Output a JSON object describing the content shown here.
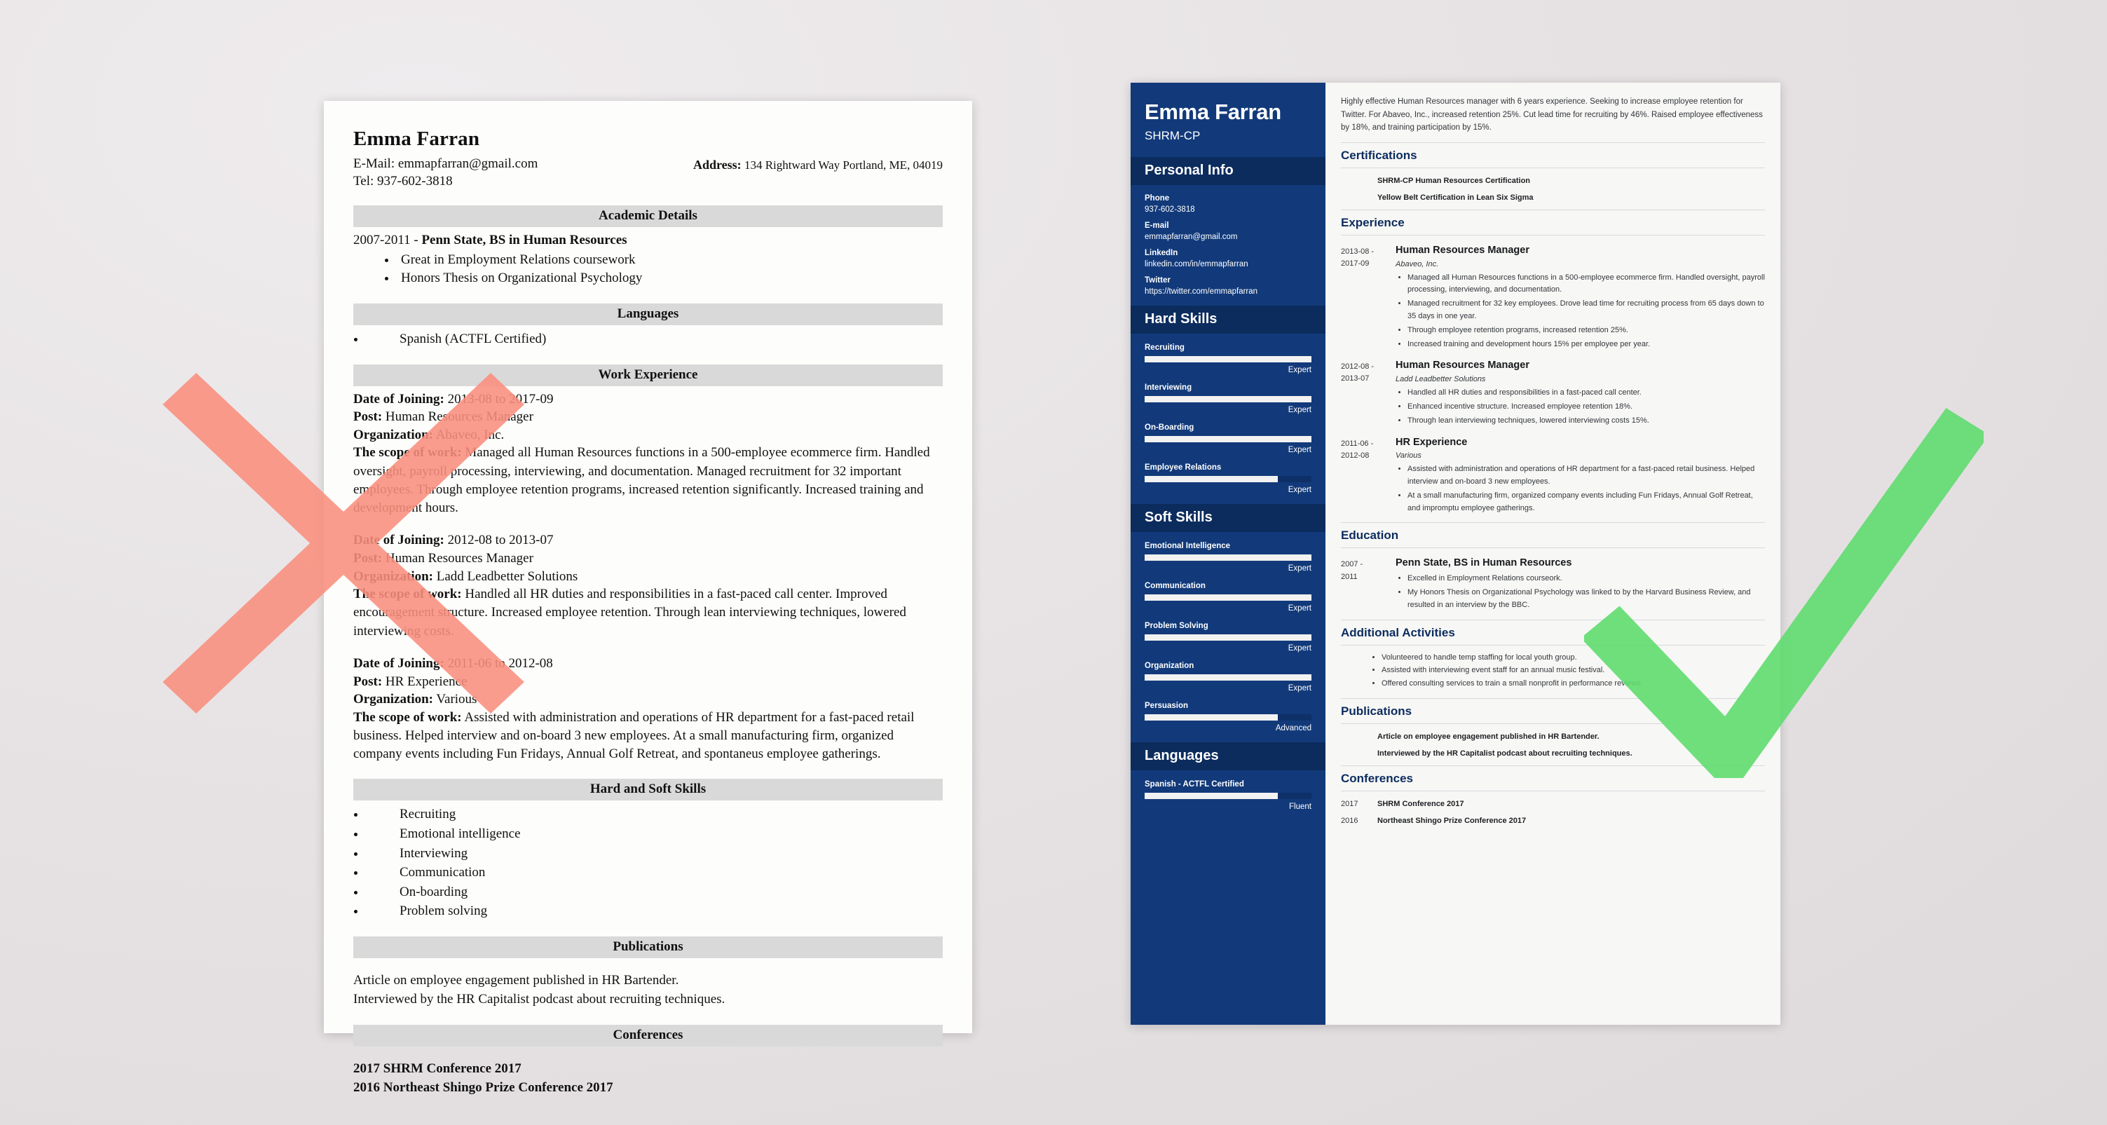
{
  "marks": {
    "reject_color": "#fa8f7e",
    "accept_color": "#5fdb6f",
    "reject_icon": "x-cross-icon",
    "accept_icon": "check-mark-icon"
  },
  "bad_resume": {
    "name": "Emma Farran",
    "email_line": "E-Mail: emmapfarran@gmail.com",
    "tel_line": "Tel: 937-602-3818",
    "address_label": "Address:",
    "address_value": "134 Rightward Way Portland, ME, 04019",
    "sections": {
      "academic": "Academic Details",
      "languages": "Languages",
      "work": "Work Experience",
      "skills": "Hard and Soft Skills",
      "publications": "Publications",
      "conferences": "Conferences"
    },
    "academic": {
      "line": "2007-2011 - Penn State, BS in Human Resources",
      "years": "2007-2011 - ",
      "degree": "Penn State, BS in Human Resources",
      "bullets": [
        "Great in Employment Relations coursework",
        "Honors Thesis on Organizational Psychology"
      ]
    },
    "languages": [
      "Spanish (ACTFL Certified)"
    ],
    "jobs": [
      {
        "date_label": "Date of Joining:",
        "date_value": " 2013-08 to 2017-09",
        "post_label": "Post:",
        "post_value": " Human Resources Manager",
        "org_label": "Organization:",
        "org_value": " Abaveo, Inc.",
        "scope_label": "The scope of work:",
        "scope_value": " Managed all Human Resources functions in a 500-employee ecommerce firm. Handled oversight, payroll processing, interviewing, and documentation. Managed recruitment for 32 important employees. Through employee retention programs, increased retention significantly. Increased training and development hours."
      },
      {
        "date_label": "Date of Joining:",
        "date_value": " 2012-08 to 2013-07",
        "post_label": "Post:",
        "post_value": " Human Resources Manager",
        "org_label": "Organization:",
        "org_value": " Ladd Leadbetter Solutions",
        "scope_label": "The scope of work:",
        "scope_value": " Handled all HR duties and responsibilities in a fast-paced call center. Improved encouragement structure. Increased employee retention. Through lean interviewing techniques, lowered interviewing costs."
      },
      {
        "date_label": "Date of Joining:",
        "date_value": " 2011-06 to 2012-08",
        "post_label": "Post:",
        "post_value": " HR Experience",
        "org_label": "Organization:",
        "org_value": " Various",
        "scope_label": "The scope of work:",
        "scope_value": " Assisted with administration and operations of HR department for a fast-paced retail business. Helped interview and on-board 3 new employees. At a small manufacturing firm, organized company events including Fun Fridays, Annual Golf Retreat, and spontaneus employee gatherings."
      }
    ],
    "skills": [
      "Recruiting",
      "Emotional intelligence",
      "Interviewing",
      "Communication",
      "On-boarding",
      "Problem solving"
    ],
    "publications": [
      "Article on employee engagement published in HR Bartender.",
      "Interviewed by the HR Capitalist podcast about recruiting techniques."
    ],
    "conferences": [
      {
        "year": "2017 ",
        "name": "SHRM Conference 2017"
      },
      {
        "year": "2016 ",
        "name": "Northeast Shingo Prize Conference 2017"
      }
    ]
  },
  "good_resume": {
    "sidebar": {
      "name": "Emma Farran",
      "title": "SHRM-CP",
      "personal_info_heading": "Personal Info",
      "contacts": [
        {
          "label": "Phone",
          "value": "937-602-3818"
        },
        {
          "label": "E-mail",
          "value": "emmapfarran@gmail.com"
        },
        {
          "label": "LinkedIn",
          "value": "linkedin.com/in/emmapfarran"
        },
        {
          "label": "Twitter",
          "value": "https://twitter.com/emmapfarran"
        }
      ],
      "hard_skills_heading": "Hard Skills",
      "hard_skills": [
        {
          "name": "Recruiting",
          "level": "Expert",
          "pct": 100
        },
        {
          "name": "Interviewing",
          "level": "Expert",
          "pct": 100
        },
        {
          "name": "On-Boarding",
          "level": "Expert",
          "pct": 100
        },
        {
          "name": "Employee Relations",
          "level": "Expert",
          "pct": 80
        }
      ],
      "soft_skills_heading": "Soft Skills",
      "soft_skills": [
        {
          "name": "Emotional Intelligence",
          "level": "Expert",
          "pct": 100
        },
        {
          "name": "Communication",
          "level": "Expert",
          "pct": 100
        },
        {
          "name": "Problem Solving",
          "level": "Expert",
          "pct": 100
        },
        {
          "name": "Organization",
          "level": "Expert",
          "pct": 100
        },
        {
          "name": "Persuasion",
          "level": "Advanced",
          "pct": 80
        }
      ],
      "languages_heading": "Languages",
      "languages": [
        {
          "name": "Spanish - ACTFL Certified",
          "level": "Fluent",
          "pct": 80
        }
      ]
    },
    "main": {
      "summary": "Highly effective Human Resources manager with 6 years experience. Seeking to increase employee retention for Twitter. For Abaveo, Inc., increased retention 25%. Cut lead time for recruiting by 46%. Raised employee effectiveness by 18%, and training participation by 15%.",
      "headings": {
        "certifications": "Certifications",
        "experience": "Experience",
        "education": "Education",
        "additional": "Additional Activities",
        "publications": "Publications",
        "conferences": "Conferences"
      },
      "certifications": [
        "SHRM-CP Human Resources Certification",
        "Yellow Belt Certification in Lean Six Sigma"
      ],
      "experience": [
        {
          "dates": "2013-08 -\n2017-09",
          "date1": "2013-08 -",
          "date2": "2017-09",
          "role": "Human Resources Manager",
          "org": "Abaveo, Inc.",
          "bullets": [
            "Managed all Human Resources functions in a 500-employee ecommerce firm. Handled oversight, payroll processing, interviewing, and documentation.",
            "Managed recruitment for 32 key employees. Drove lead time for recruiting process from 65 days down to 35 days in one year.",
            "Through employee retention programs, increased retention 25%.",
            "Increased training and development hours 15% per employee per year."
          ]
        },
        {
          "date1": "2012-08 -",
          "date2": "2013-07",
          "role": "Human Resources Manager",
          "org": "Ladd Leadbetter Solutions",
          "bullets": [
            "Handled all HR duties and responsibilities in a fast-paced call center.",
            "Enhanced incentive structure. Increased employee retention 18%.",
            "Through lean interviewing techniques, lowered interviewing costs 15%."
          ]
        },
        {
          "date1": "2011-06 -",
          "date2": "2012-08",
          "role": "HR Experience",
          "org": "Various",
          "bullets": [
            "Assisted with administration and operations of HR department for a fast-paced retail business. Helped interview and on-board 3 new employees.",
            "At a small manufacturing firm, organized company events including Fun Fridays, Annual Golf Retreat, and impromptu employee gatherings."
          ]
        }
      ],
      "education": [
        {
          "date1": "2007 -",
          "date2": "2011",
          "role": "Penn State, BS in Human Resources",
          "bullets": [
            "Excelled in Employment Relations courseork.",
            "My Honors Thesis on Organizational Psychology was linked to by the Harvard Business Review, and resulted in an interview by the BBC."
          ]
        }
      ],
      "additional_activities": [
        "Volunteered to handle temp staffing for local youth group.",
        "Assisted with interviewing event staff for an annual music festival.",
        "Offered consulting services to train a small nonprofit in performance reviews."
      ],
      "publications": [
        "Article on employee engagement published in HR Bartender.",
        "Interviewed by the HR Capitalist podcast about recruiting techniques."
      ],
      "conferences": [
        {
          "year": "2017",
          "name": "SHRM Conference 2017"
        },
        {
          "year": "2016",
          "name": "Northeast Shingo Prize Conference 2017"
        }
      ]
    }
  }
}
